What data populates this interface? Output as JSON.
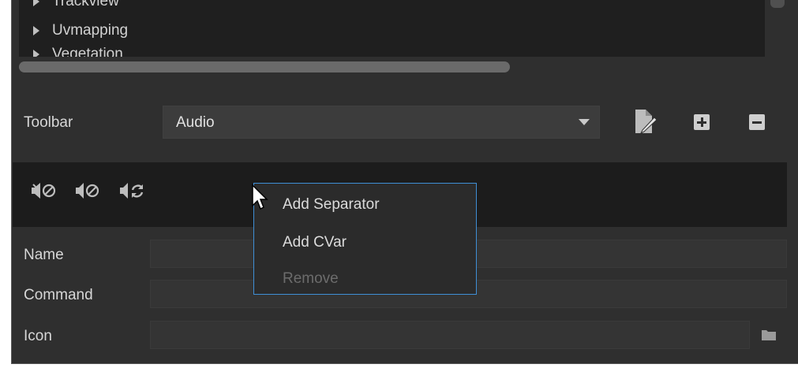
{
  "tree": {
    "items": [
      {
        "label": "Trackview"
      },
      {
        "label": "Uvmapping"
      },
      {
        "label": "Vegetation"
      }
    ]
  },
  "toolbar": {
    "label": "Toolbar",
    "selected": "Audio",
    "buttons": {
      "edit_icon": "pencil-page-icon",
      "add_icon": "plus-icon",
      "remove_icon": "minus-icon"
    }
  },
  "icons": [
    "audio-mute-icon",
    "audio-stop-icon",
    "audio-refresh-icon"
  ],
  "fields": {
    "name_label": "Name",
    "command_label": "Command",
    "icon_label": "Icon",
    "name_value": "",
    "command_value": "",
    "icon_value": ""
  },
  "context_menu": {
    "items": [
      {
        "label": "Add Separator",
        "enabled": true
      },
      {
        "label": "Add CVar",
        "enabled": true
      },
      {
        "label": "Remove",
        "enabled": false
      }
    ]
  },
  "colors": {
    "panel": "#2f2f2f",
    "menu_border": "#3f8fd6"
  }
}
